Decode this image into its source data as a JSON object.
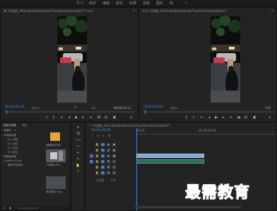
{
  "workspace_tabs": [
    "学习",
    "组件",
    "编辑",
    "颜色",
    "效果",
    "音频",
    "图形",
    "库"
  ],
  "source_monitor": {
    "title": "源: 01视频_a9f12a0bd6e8a04c0b75aa49ea3d14ea5b6d77.mp4",
    "timecode_left": "00;00;00;00",
    "fit": "适合",
    "fraction": "1/2",
    "timecode_right": "00;00;03;11"
  },
  "program_monitor": {
    "title": "节目: 01视频_a9f12a0bd6e8a04c0b75aa49ea3d14ea5b6d77",
    "timecode_left": "00;00;00;00",
    "fit": "适合",
    "quality": "完整",
    "timecode_right": "00;00;03;11"
  },
  "project_panel": {
    "tabs": [
      "媒体浏览器",
      "项目"
    ],
    "path_label": "收藏夹",
    "tree": [
      "本地驱动器",
      "(C:) 系统",
      "(D:) 软件",
      "(E:) 文档",
      "(F:) 影视",
      "网络驱动器",
      "Creative Cloud",
      "团队项目版本"
    ],
    "thumb_labels": [
      "01视频_a9f...",
      "音效素材.mp4"
    ],
    "folder_label": "配套素材文件"
  },
  "timeline": {
    "title": "01视频_a9f12a0bd6e8a04c0b75aa49ea3d14ea5b6d77",
    "timecode": "00;00;00;00",
    "ruler": [
      "00;00",
      "00;00;04;00"
    ],
    "tracks": [
      "V3",
      "V2",
      "V1",
      "A1",
      "A2",
      "A3",
      "主声道"
    ],
    "master_value": "0.0"
  },
  "watermark": "最需教育",
  "colors": {
    "accent_blue": "#2d8ceb",
    "panel_bg": "#232323",
    "video_clip": "#7ea8d6",
    "audio_clip": "#2f6a5e",
    "watermark_blue": "#2a4a9a"
  }
}
